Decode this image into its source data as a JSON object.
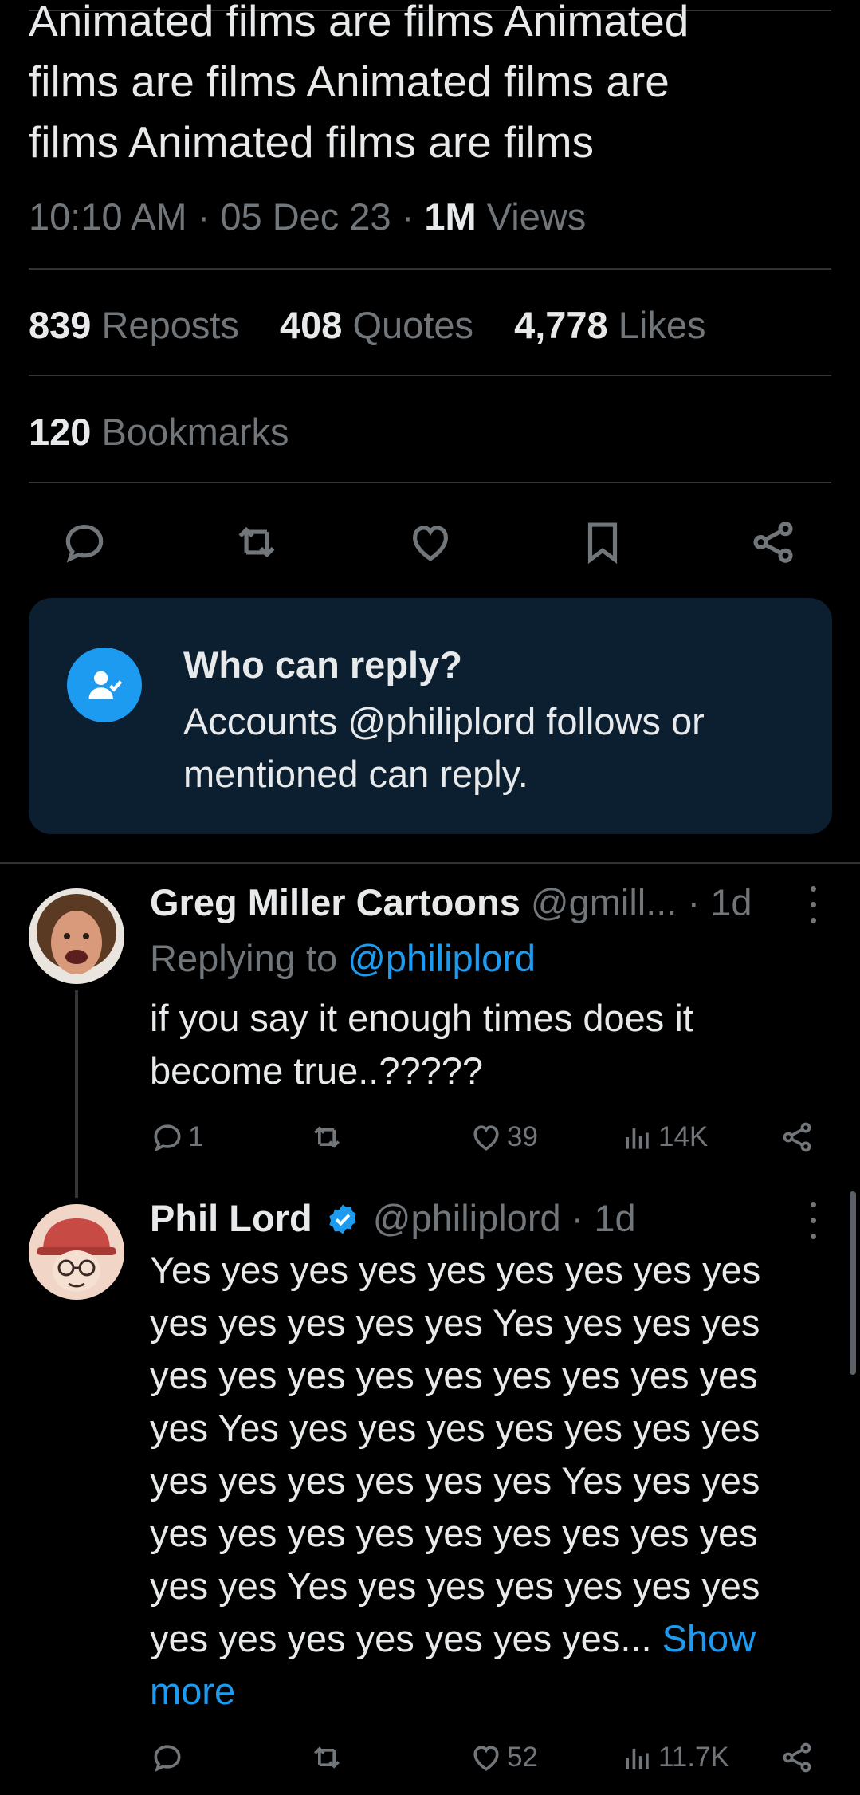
{
  "tweet": {
    "text": "Animated films are films Animated\nfilms are films Animated films are\nfilms Animated films are films",
    "time": "10:10 AM",
    "date": "05 Dec 23",
    "views_count": "1M",
    "views_label": "Views",
    "separator": "·"
  },
  "stats": {
    "reposts_count": "839",
    "reposts_label": "Reposts",
    "quotes_count": "408",
    "quotes_label": "Quotes",
    "likes_count": "4,778",
    "likes_label": "Likes",
    "bookmarks_count": "120",
    "bookmarks_label": "Bookmarks"
  },
  "actions": [
    "reply-icon",
    "repost-icon",
    "like-icon",
    "bookmark-icon",
    "share-icon"
  ],
  "reply_restriction": {
    "title": "Who can reply?",
    "description": "Accounts @philiplord follows or mentioned can reply."
  },
  "replies": [
    {
      "name": "Greg Miller Cartoons",
      "handle": "@gmill...",
      "age": "· 1d",
      "replying_prefix": "Replying to",
      "replying_to": "@philiplord",
      "text": "if you say it enough times does it become true..?????",
      "reply_count": "1",
      "repost_count": "",
      "like_count": "39",
      "view_count": "14K"
    },
    {
      "name": "Phil Lord",
      "handle": "@philiplord",
      "age": "· 1d",
      "verified": true,
      "text": "Yes yes yes yes yes yes yes yes yes yes yes yes yes yes Yes yes yes yes yes yes yes yes yes yes yes yes yes yes Yes yes yes yes yes yes yes yes yes yes yes yes yes yes Yes yes yes yes yes yes yes yes yes yes yes yes yes yes Yes yes yes yes yes yes yes yes yes yes yes yes yes yes...",
      "show_more": "Show more",
      "reply_count": "",
      "repost_count": "",
      "like_count": "52",
      "view_count": "11.7K"
    }
  ],
  "colors": {
    "background": "#000000",
    "text": "#e7e9ea",
    "muted": "#71767b",
    "accent": "#1d9bf0",
    "card": "#0b1f30"
  }
}
